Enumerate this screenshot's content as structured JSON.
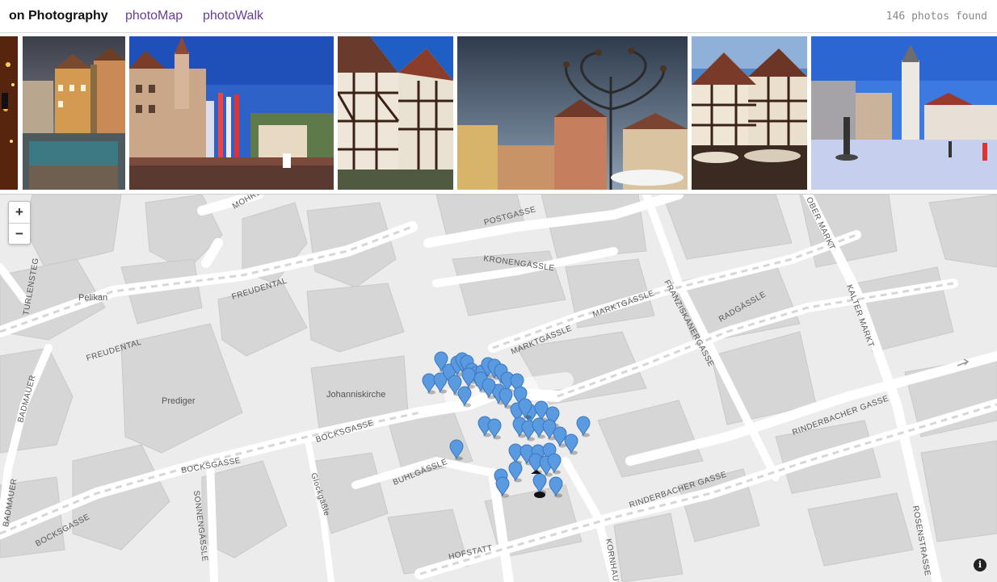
{
  "header": {
    "brand": "on Photography",
    "nav": [
      "photoMap",
      "photoWalk"
    ],
    "photo_count": "146 photos found"
  },
  "photos": [
    {
      "name": "photo-lights",
      "subject": "night lights"
    },
    {
      "name": "photo-fountain",
      "subject": "fountain square"
    },
    {
      "name": "photo-marketplace",
      "subject": "market place tower"
    },
    {
      "name": "photo-half-timbered",
      "subject": "half-timbered houses"
    },
    {
      "name": "photo-sculpture",
      "subject": "square sculpture"
    },
    {
      "name": "photo-timber-cafe",
      "subject": "half-timbered cafe"
    },
    {
      "name": "photo-town-square",
      "subject": "town square"
    }
  ],
  "map": {
    "zoom_in": "+",
    "zoom_out": "−",
    "info": "i",
    "street_labels": [
      "MOHRENGASSE",
      "POSTGASSE",
      "KRONENGÄSSLE",
      "FREUDENTAL",
      "FREUDENTAL",
      "TURLENSTEG",
      "MARKTGÄSSLE",
      "MARKTGÄSSLE",
      "FRANZISKANERGASSE",
      "RADGÄSSLE",
      "KALTER MARKT",
      "OBER MARKT",
      "RINDERBACHER GASSE",
      "RINDERBACHER GASSE",
      "BOCKSGASSE",
      "BOCKSGASSE",
      "BOCKSGASSE",
      "BUHLGÄSSLE",
      "Glockgäßle",
      "SONNENGÄSSLE",
      "HOFSTATT",
      "KORNHAUS",
      "ROSENSTRASSE",
      "BADMAUER",
      "BADMAUER"
    ],
    "place_labels": [
      "Pelikan",
      "Prediger",
      "Johanniskirche"
    ],
    "marker_color": "#5a9ae0"
  }
}
